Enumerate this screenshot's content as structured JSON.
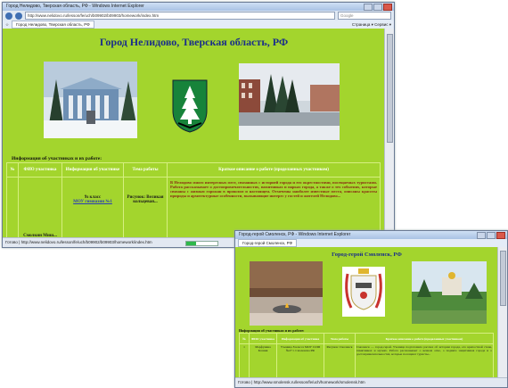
{
  "main_window": {
    "title": "Город Нелидово, Тверская область, РФ - Windows Internet Explorer",
    "url": "http://www.nelidovo.ru/lesson/fe/uch/b09902/b09903/homework/index.htm",
    "search_placeholder": "Google",
    "tab_label": "Город Нелидово, Тверская область, РФ",
    "toolbar_tools": "Страница ▾  Сервис ▾",
    "page_title": "Город Нелидово, Тверская область, РФ",
    "info_heading": "Информация об участниках и их работе:",
    "table": {
      "headers": [
        "№",
        "ФИО участника",
        "Информация об участнике",
        "Тема работы",
        "Краткое описание о работе (проделанных участником)"
      ],
      "row": {
        "fio": "Смолкин Миш...",
        "info_prefix": "9з класс",
        "info_link": "МОУ гимназии №1",
        "theme": "Рисунок: Великая кольцевая...",
        "description": "В Нелидово много интересных мест, связанных с историей города и его окрестностями, посещаемых туристами. Работа рассказывает о достопримечательностях, памятниках и парках города, а также о тех событиях, которые связаны с жизнью горожан в прошлом и настоящем. Отмечены наиболее известные места, описаны красоты природы и архитектурные особенности, вызывающие интерес у гостей и жителей Нелидово..."
      }
    },
    "status_text": "Готово | http://www.nelidovo.ru/lesson/fe/uch/b09902/b09903/homework/index.htm"
  },
  "sub_window": {
    "title": "Город-герой Смоленск, РФ - Windows Internet Explorer",
    "url": "http://www.smolensk.ru/lesson/fe/uch/b09902/b09903/homework/smolensk.htm",
    "tab_label": "Город-герой Смоленск, РФ",
    "page_title": "Город-герой Смоленск, РФ",
    "info_heading": "Информация об участниках и их работе:",
    "table": {
      "headers": [
        "№",
        "ФИО участника",
        "Информация об участнике",
        "Тема работы",
        "Краткое описание о работе (проделанных участником)"
      ],
      "row": {
        "num": "1",
        "fio": "Марфунина Ксения",
        "info": "Ученица 8 класса МОУ СОШ №27 г. Смоленска РФ",
        "theme": "Рисунок: Смоленск",
        "description": "Смоленск — город-герой. Ученица подготовила рассказ об истории города, его крепостной стене, памятниках и музеях. Работа рассказывает о вечном огне, о подвиге защитников города и о достопримечательностях, которые посещают туристы..."
      }
    },
    "status_text": "Готово | http://www.smolensk.ru/lesson/fe/uch/homework/smolensk.htm"
  },
  "colors": {
    "page_bg": "#a3d52d",
    "title_blue": "#1a2e8a",
    "header_text": "#ffffff"
  },
  "progress": {
    "main": 0.3,
    "sub": 0.0
  }
}
